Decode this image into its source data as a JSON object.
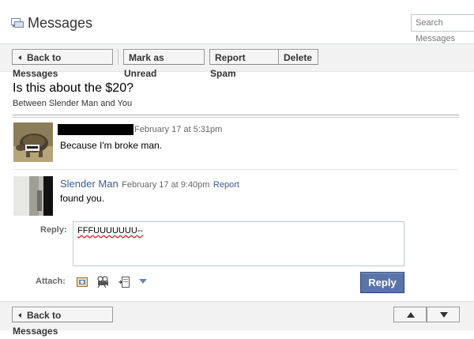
{
  "header": {
    "title": "Messages",
    "search_placeholder": "Search Messages"
  },
  "toolbar": {
    "back_label": "Back to Messages",
    "mark_unread_label": "Mark as Unread",
    "report_spam_label": "Report Spam",
    "delete_label": "Delete"
  },
  "thread": {
    "subject": "Is this about the $20?",
    "between": "Between Slender Man and You"
  },
  "messages": [
    {
      "author": "",
      "timestamp": "February 17 at 5:31pm",
      "text": "Because I'm broke man."
    },
    {
      "author": "Slender Man",
      "timestamp": "February 17 at 9:40pm",
      "report_label": "Report",
      "text": "found you."
    }
  ],
  "reply": {
    "label": "Reply:",
    "value": "FFFUUUUUUU--",
    "attach_label": "Attach:",
    "button_label": "Reply"
  },
  "footer": {
    "back_label": "Back to Messages"
  },
  "colors": {
    "brand_blue": "#3b5998",
    "reply_button": "#5b74a8"
  }
}
